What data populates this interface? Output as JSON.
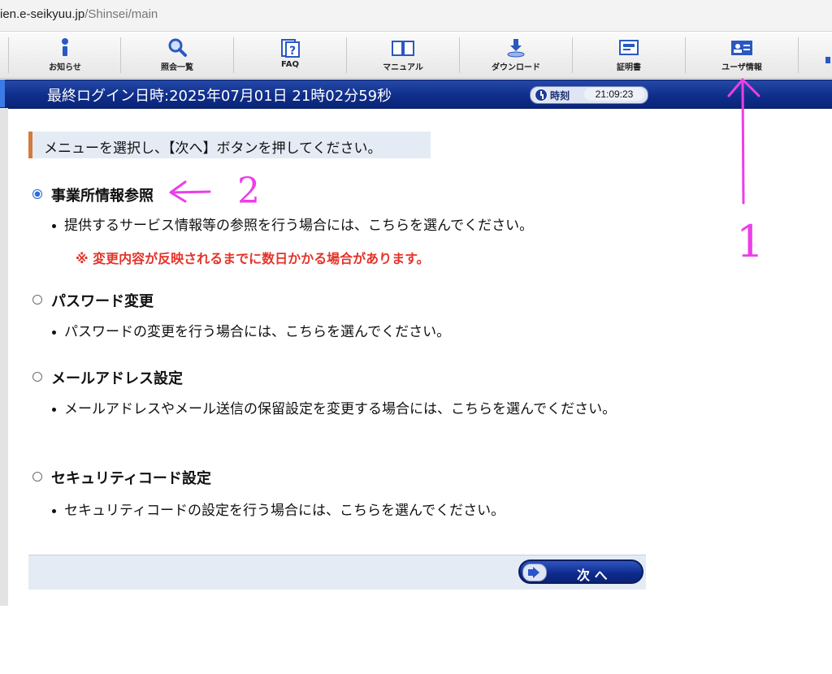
{
  "browser": {
    "url_host": "ien.e-seikyuu.jp",
    "url_path": "/Shinsei/main"
  },
  "toolbar": {
    "items": [
      {
        "label": "お知らせ",
        "icon": "info-icon"
      },
      {
        "label": "照会一覧",
        "icon": "magnifier-icon"
      },
      {
        "label": "FAQ",
        "icon": "faq-icon"
      },
      {
        "label": "マニュアル",
        "icon": "book-icon"
      },
      {
        "label": "ダウンロード",
        "icon": "download-icon"
      },
      {
        "label": "証明書",
        "icon": "certificate-icon"
      },
      {
        "label": "ユーザ情報",
        "icon": "user-card-icon"
      }
    ]
  },
  "header": {
    "last_login": "最終ログイン日時:2025年07月01日 21時02分59秒",
    "clock_label": "時刻",
    "clock_time": "21:09:23"
  },
  "main": {
    "instruction": "メニューを選択し、【次へ】ボタンを押してください。",
    "options": [
      {
        "title": "事業所情報参照",
        "selected": true,
        "desc": "提供するサービス情報等の参照を行う場合には、こちらを選んでください。"
      },
      {
        "title": "パスワード変更",
        "selected": false,
        "desc": "パスワードの変更を行う場合には、こちらを選んでください。"
      },
      {
        "title": "メールアドレス設定",
        "selected": false,
        "desc": "メールアドレスやメール送信の保留設定を変更する場合には、こちらを選んでください。"
      },
      {
        "title": "セキュリティコード設定",
        "selected": false,
        "desc": "セキュリティコードの設定を行う場合には、こちらを選んでください。"
      }
    ],
    "warning": "※ 変更内容が反映されるまでに数日かかる場合があります。",
    "next_label": "次 へ"
  },
  "annotations": {
    "label_1": "1",
    "label_2": "2",
    "color": "#ec3ee8"
  }
}
